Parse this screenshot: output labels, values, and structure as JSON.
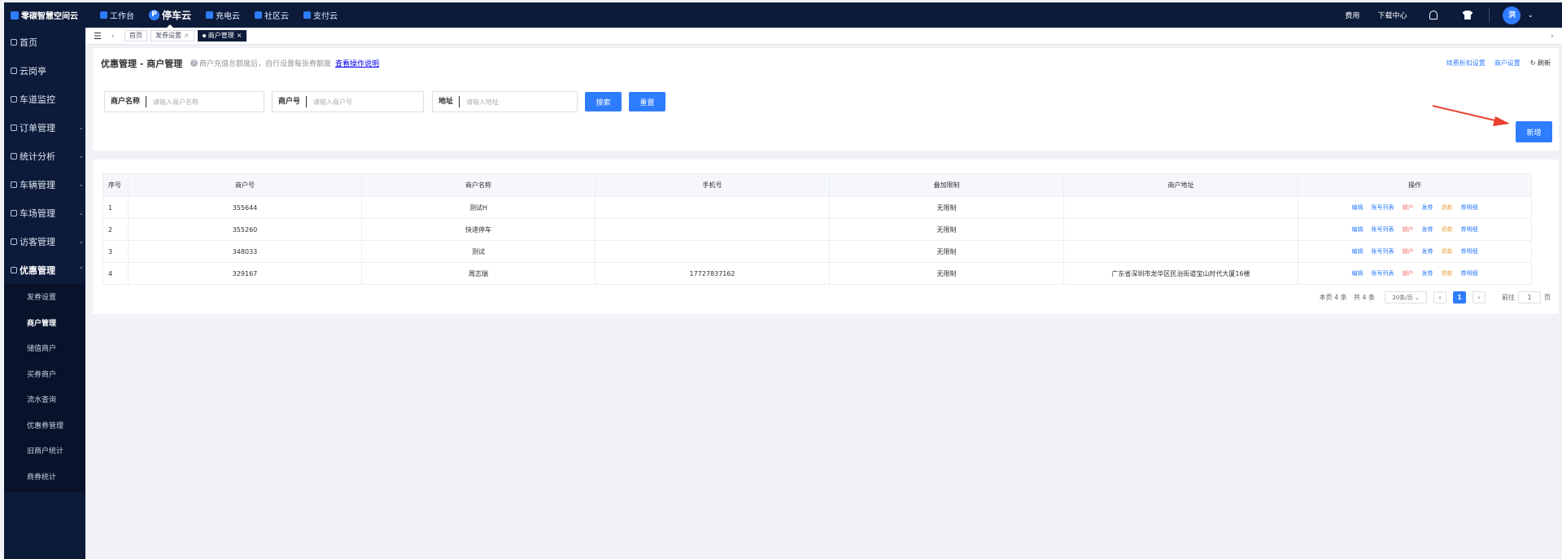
{
  "topbar": {
    "brand": "零碳智慧空间云",
    "nav": [
      {
        "label": "工作台",
        "icon": "workbench-icon",
        "active": false
      },
      {
        "label": "停车云",
        "icon": "parking-p-icon",
        "icon_glyph": "P",
        "active": true
      },
      {
        "label": "充电云",
        "icon": "charging-icon",
        "active": false
      },
      {
        "label": "社区云",
        "icon": "community-icon",
        "active": false
      },
      {
        "label": "支付云",
        "icon": "payment-icon",
        "active": false
      }
    ],
    "fee": "费用",
    "download": "下载中心",
    "avatar": "洪"
  },
  "sidebar": {
    "items": [
      {
        "label": "首页"
      },
      {
        "label": "云岗亭"
      },
      {
        "label": "车道监控"
      },
      {
        "label": "订单管理"
      },
      {
        "label": "统计分析"
      },
      {
        "label": "车辆管理"
      },
      {
        "label": "车场管理"
      },
      {
        "label": "访客管理"
      },
      {
        "label": "优惠管理"
      }
    ],
    "sub_items": [
      {
        "label": "发券设置",
        "active": false
      },
      {
        "label": "商户管理",
        "active": true
      },
      {
        "label": "储值商户",
        "active": false
      },
      {
        "label": "买券商户",
        "active": false
      },
      {
        "label": "流水查询",
        "active": false
      },
      {
        "label": "优惠券管理",
        "active": false
      },
      {
        "label": "旧商户统计",
        "active": false
      },
      {
        "label": "商券统计",
        "active": false
      }
    ]
  },
  "tabs": [
    {
      "label": "首页",
      "closable": false,
      "active": false
    },
    {
      "label": "发券设置",
      "closable": true,
      "active": false
    },
    {
      "label": "商户管理",
      "closable": true,
      "active": true
    }
  ],
  "header": {
    "title": "优惠管理 - 商户管理",
    "tip": "商户充值总额度后，自行设置每张券额度",
    "tip_link": "查看操作说明",
    "links": [
      "续费折扣设置",
      "商户设置"
    ],
    "refresh": "刷新"
  },
  "filters": [
    {
      "label": "商户名称",
      "placeholder": "请输入商户名称",
      "value": ""
    },
    {
      "label": "商户号",
      "placeholder": "请输入商户号",
      "value": ""
    },
    {
      "label": "地址",
      "placeholder": "请输入地址",
      "value": ""
    }
  ],
  "buttons": {
    "search": "搜索",
    "reset": "重置",
    "add": "新增"
  },
  "annotation": {
    "color": "#e8412f"
  },
  "table": {
    "columns": [
      "序号",
      "商户号",
      "商户名称",
      "手机号",
      "叠加限制",
      "商户地址",
      "操作"
    ],
    "rows": [
      [
        "1",
        "355644",
        "测试H",
        "",
        "无限制",
        ""
      ],
      [
        "2",
        "355260",
        "快递停车",
        "",
        "无限制",
        ""
      ],
      [
        "3",
        "348033",
        "测试",
        "",
        "无限制",
        ""
      ],
      [
        "4",
        "329167",
        "周志瑞",
        "17727837162",
        "无限制",
        "广东省深圳市龙华区民治街道宝山时代大厦16楼"
      ]
    ],
    "actions": [
      {
        "label": "编辑",
        "color": "#2f7dff"
      },
      {
        "label": "账号列表",
        "color": "#2f7dff"
      },
      {
        "label": "销户",
        "color": "#f56c6c"
      },
      {
        "label": "发券",
        "color": "#2f7dff"
      },
      {
        "label": "退款",
        "color": "#e6a23c"
      },
      {
        "label": "券明细",
        "color": "#2f7dff"
      }
    ]
  },
  "pager": {
    "page_count_text": "本页 4 条",
    "total_text": "共 4 条",
    "size": "20条/页",
    "current": "1",
    "goto_label": "前往",
    "goto_value": "1",
    "page_suffix": "页"
  },
  "colors": {
    "primary": "#2f7dff",
    "nav_bg": "#0d1b3a",
    "danger": "#f56c6c",
    "warning": "#e6a23c"
  }
}
